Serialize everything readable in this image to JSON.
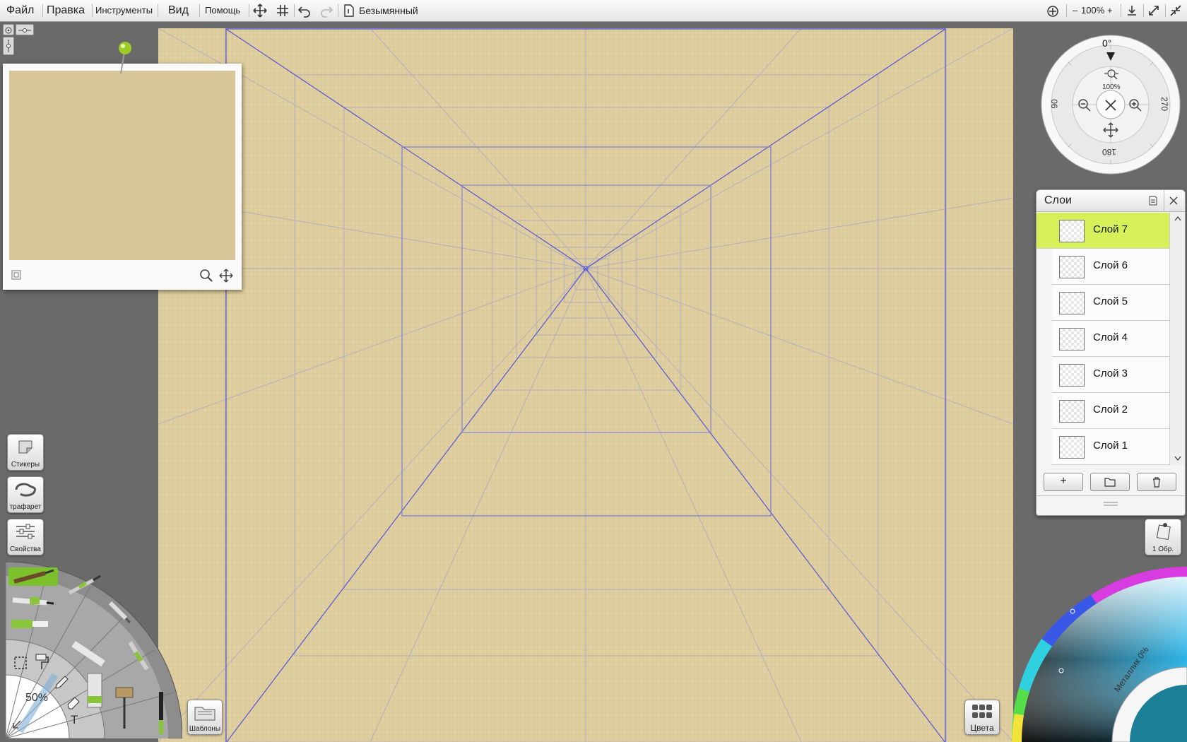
{
  "menu": {
    "file": "Файл",
    "edit": "Правка",
    "tools": "Инструменты",
    "view": "Вид",
    "help": "Помощь",
    "doc_title": "Безымянный",
    "zoom_minus": "–",
    "zoom_value": "100%",
    "zoom_plus": "+"
  },
  "rotation_dial": {
    "top": "0°",
    "left": "90",
    "right": "270",
    "bottom": "180",
    "zoom": "100%"
  },
  "layers_panel": {
    "title": "Слои",
    "layers": [
      "Слой 7",
      "Слой 6",
      "Слой 5",
      "Слой 4",
      "Слой 3",
      "Слой 2",
      "Слой 1"
    ],
    "selected": "Слой 7",
    "add_button": "+"
  },
  "side_buttons": {
    "stickers": "Стикеры",
    "stencils": "трафарет",
    "properties": "Свойства"
  },
  "tool_wheel": {
    "size": "50%",
    "text_tool": "T"
  },
  "bottom": {
    "templates": "Шаблоны",
    "colors": "Цвета"
  },
  "tracing": {
    "count_label": "1 Обр."
  },
  "color_picker": {
    "metallic": "Металлик 0%"
  },
  "colors": {
    "canvas": "#e0cfa0",
    "accent_selected": "#d6f05a",
    "guide_line": "#4b4fd6"
  }
}
